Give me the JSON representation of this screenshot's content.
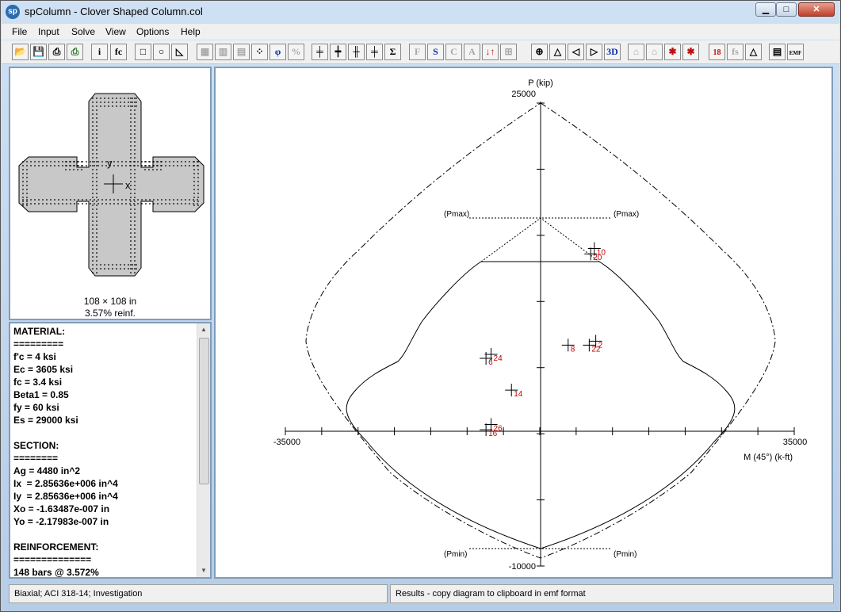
{
  "window": {
    "title": "spColumn - Clover Shaped Column.col",
    "app_icon": "sp"
  },
  "menu": [
    "File",
    "Input",
    "Solve",
    "View",
    "Options",
    "Help"
  ],
  "toolbar": {
    "groups": [
      [
        "open-icon",
        "save-icon",
        "print-icon",
        "print-color-icon"
      ],
      [
        "info-icon",
        "fc-icon"
      ],
      [
        "rectangle-icon",
        "circle-icon",
        "irregular-icon"
      ],
      [
        "bars-all-sides-icon",
        "bars-two-sides-icon",
        "bars-four-sides-icon",
        "bars-irregular-icon",
        "phi-icon",
        "percent-icon"
      ],
      [
        "design-icon",
        "investigate-icon",
        "slenderness-icon",
        "load-icon",
        "sum-icon"
      ],
      [
        "F-icon",
        "S-icon",
        "C-icon",
        "A-icon",
        "loads-icon",
        "grid-icon"
      ],
      [
        "view-pm-icon",
        "view-3d-up-icon",
        "view-3d-left-icon",
        "view-3d-right-icon",
        "3D-icon"
      ],
      [
        "zoom-in-icon",
        "zoom-out-icon",
        "scale-icon",
        "fit-icon"
      ],
      [
        "bar-18-icon",
        "fs-icon",
        "fs-plot-icon"
      ],
      [
        "report-icon",
        "emf-icon"
      ]
    ],
    "labels": {
      "F": "F",
      "S": "S",
      "C": "C",
      "A": "A",
      "threeD": "3D",
      "bar18": "18",
      "fc": "fc",
      "phi": "φ",
      "pct": "%",
      "sum": "Σ",
      "fs": "fs",
      "emf": "EMF"
    }
  },
  "section_view": {
    "axis_x": "x",
    "axis_y": "y",
    "dimensions": "108 × 108 in",
    "reinf": "3.57% reinf."
  },
  "properties_text": "MATERIAL:\n=========\nf'c = 4 ksi\nEc = 3605 ksi\nfc = 3.4 ksi\nBeta1 = 0.85\nfy = 60 ksi\nEs = 29000 ksi\n\nSECTION:\n========\nAg = 4480 in^2\nIx  = 2.85636e+006 in^4\nIy  = 2.85636e+006 in^4\nXo = -1.63487e-007 in\nYo = -2.17983e-007 in\n\nREINFORCEMENT:\n==============\n148 bars @ 3.572%",
  "chart_data": {
    "type": "scatter",
    "title": "",
    "ylabel": "P (kip)",
    "xlabel": "M (45°) (k-ft)",
    "xlim": [
      -35000,
      35000
    ],
    "ylim": [
      -10000,
      25000
    ],
    "tick_labels": {
      "x_min": "-35000",
      "x_max": "35000",
      "y_max": "25000",
      "y_min": "-10000"
    },
    "pmax_label": "(Pmax)",
    "pmin_label": "(Pmin)",
    "load_points": [
      {
        "label": "10",
        "m": 7500,
        "p": 14000
      },
      {
        "label": "20",
        "m": 7000,
        "p": 13600
      },
      {
        "label": "2",
        "m": 7700,
        "p": 7000
      },
      {
        "label": "22",
        "m": 6800,
        "p": 6700
      },
      {
        "label": "8",
        "m": 3900,
        "p": 6700
      },
      {
        "label": "24",
        "m": -6700,
        "p": 6000
      },
      {
        "label": "6",
        "m": -7400,
        "p": 5700
      },
      {
        "label": "14",
        "m": -3900,
        "p": 3300
      },
      {
        "label": "26",
        "m": -6700,
        "p": 700
      },
      {
        "label": "16",
        "m": -7400,
        "p": 300
      }
    ]
  },
  "status": {
    "left": "Biaxial; ACI 318-14; Investigation",
    "right": "Results - copy diagram to clipboard in emf format"
  }
}
